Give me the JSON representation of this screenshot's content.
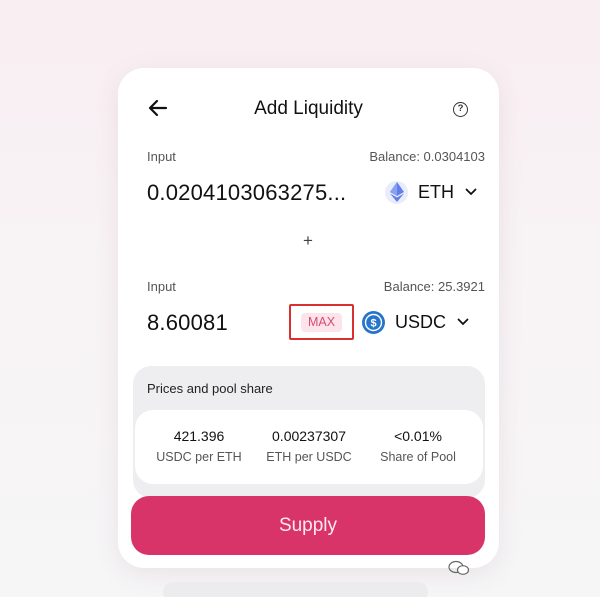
{
  "header": {
    "title": "Add Liquidity",
    "back_icon": "arrow-left-icon",
    "help_icon": "question-circle-icon",
    "help_glyph": "?"
  },
  "input_a": {
    "label": "Input",
    "balance": "Balance: 0.0304103",
    "amount": "0.0204103063275...",
    "token": "ETH",
    "token_icon": "ethereum-icon",
    "token_color": "#627eea"
  },
  "plus": "+",
  "input_b": {
    "label": "Input",
    "balance": "Balance: 25.3921",
    "amount": "8.60081",
    "max_label": "MAX",
    "token": "USDC",
    "token_icon": "usdc-icon",
    "token_color": "#2775ca"
  },
  "prices": {
    "title": "Prices and pool share",
    "stats": [
      {
        "value": "421.396",
        "label": "USDC per ETH"
      },
      {
        "value": "0.00237307",
        "label": "ETH per USDC"
      },
      {
        "value": "<0.01%",
        "label": "Share of Pool"
      }
    ]
  },
  "supply_label": "Supply",
  "colors": {
    "accent": "#d8346a",
    "max_text": "#d84a74",
    "highlight_border": "#d93030"
  }
}
